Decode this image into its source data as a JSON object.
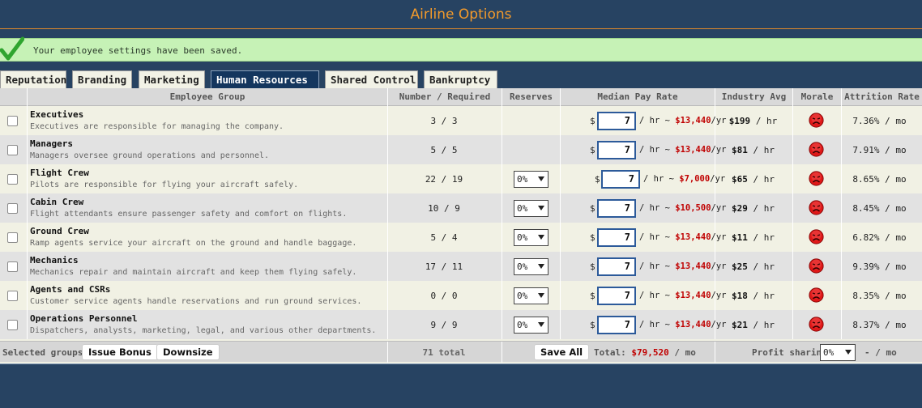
{
  "title": "Airline Options",
  "notice": {
    "message": "Your employee settings have been saved."
  },
  "tabs": [
    {
      "label": "Reputation",
      "active": false
    },
    {
      "label": "Branding",
      "active": false
    },
    {
      "label": "Marketing",
      "active": false
    },
    {
      "label": "Human Resources",
      "active": true
    },
    {
      "label": "Shared Control",
      "active": false
    },
    {
      "label": "Bankruptcy",
      "active": false
    }
  ],
  "columns": {
    "group": "Employee Group",
    "number": "Number / Required",
    "reserves": "Reserves",
    "pay": "Median Pay Rate",
    "industry": "Industry Avg",
    "morale": "Morale",
    "attrition": "Attrition Rate"
  },
  "rows": [
    {
      "name": "Executives",
      "desc": "Executives are responsible for managing the company.",
      "number": "3 / 3",
      "reserves": "",
      "dollar": "$",
      "pay": "7",
      "per_hr": "/ hr ~",
      "yearly": "$13,440",
      "per_yr": "/yr",
      "industry": "$199",
      "industry_unit": "/ hr",
      "attrition": "7.36% / mo",
      "morale": "unhappy-face-icon"
    },
    {
      "name": "Managers",
      "desc": "Managers oversee ground operations and personnel.",
      "number": "5 / 5",
      "reserves": "",
      "dollar": "$",
      "pay": "7",
      "per_hr": "/ hr ~",
      "yearly": "$13,440",
      "per_yr": "/yr",
      "industry": "$81",
      "industry_unit": "/ hr",
      "attrition": "7.91% / mo",
      "morale": "unhappy-face-icon"
    },
    {
      "name": "Flight Crew",
      "desc": "Pilots are responsible for flying your aircraft safely.",
      "number": "22 / 19",
      "reserves": "0%",
      "dollar": "$",
      "pay": "7",
      "per_hr": "/ hr ~",
      "yearly": "$7,000",
      "per_yr": "/yr",
      "industry": "$65",
      "industry_unit": "/ hr",
      "attrition": "8.65% / mo",
      "morale": "unhappy-face-icon"
    },
    {
      "name": "Cabin Crew",
      "desc": "Flight attendants ensure passenger safety and comfort on flights.",
      "number": "10 / 9",
      "reserves": "0%",
      "dollar": "$",
      "pay": "7",
      "per_hr": "/ hr ~",
      "yearly": "$10,500",
      "per_yr": "/yr",
      "industry": "$29",
      "industry_unit": "/ hr",
      "attrition": "8.45% / mo",
      "morale": "unhappy-face-icon"
    },
    {
      "name": "Ground Crew",
      "desc": "Ramp agents service your aircraft on the ground and handle baggage.",
      "number": "5 / 4",
      "reserves": "0%",
      "dollar": "$",
      "pay": "7",
      "per_hr": "/ hr ~",
      "yearly": "$13,440",
      "per_yr": "/yr",
      "industry": "$11",
      "industry_unit": "/ hr",
      "attrition": "6.82% / mo",
      "morale": "unhappy-face-icon"
    },
    {
      "name": "Mechanics",
      "desc": "Mechanics repair and maintain aircraft and keep them flying safely.",
      "number": "17 / 11",
      "reserves": "0%",
      "dollar": "$",
      "pay": "7",
      "per_hr": "/ hr ~",
      "yearly": "$13,440",
      "per_yr": "/yr",
      "industry": "$25",
      "industry_unit": "/ hr",
      "attrition": "9.39% / mo",
      "morale": "unhappy-face-icon"
    },
    {
      "name": "Agents and CSRs",
      "desc": "Customer service agents handle reservations and run ground services.",
      "number": "0 / 0",
      "reserves": "0%",
      "dollar": "$",
      "pay": "7",
      "per_hr": "/ hr ~",
      "yearly": "$13,440",
      "per_yr": "/yr",
      "industry": "$18",
      "industry_unit": "/ hr",
      "attrition": "8.35% / mo",
      "morale": "unhappy-face-icon"
    },
    {
      "name": "Operations Personnel",
      "desc": "Dispatchers, analysts, marketing, legal, and various other departments.",
      "number": "9 / 9",
      "reserves": "0%",
      "dollar": "$",
      "pay": "7",
      "per_hr": "/ hr ~",
      "yearly": "$13,440",
      "per_yr": "/yr",
      "industry": "$21",
      "industry_unit": "/ hr",
      "attrition": "8.37% / mo",
      "morale": "unhappy-face-icon"
    }
  ],
  "footer": {
    "selected_label": "Selected groups:",
    "issue_bonus": "Issue Bonus",
    "downsize": "Downsize",
    "total_employees": "71 total",
    "save_all": "Save All",
    "total_label": "Total:",
    "total_value": "$79,520",
    "total_unit": "/ mo",
    "profit_label": "Profit sharing:",
    "profit_value": "0%",
    "profit_result": "- / mo"
  },
  "colors": {
    "background": "#274362",
    "title": "#f39a2b",
    "active_tab": "#14365e",
    "notice": "#c6f2b6",
    "money_red": "#c00000"
  }
}
